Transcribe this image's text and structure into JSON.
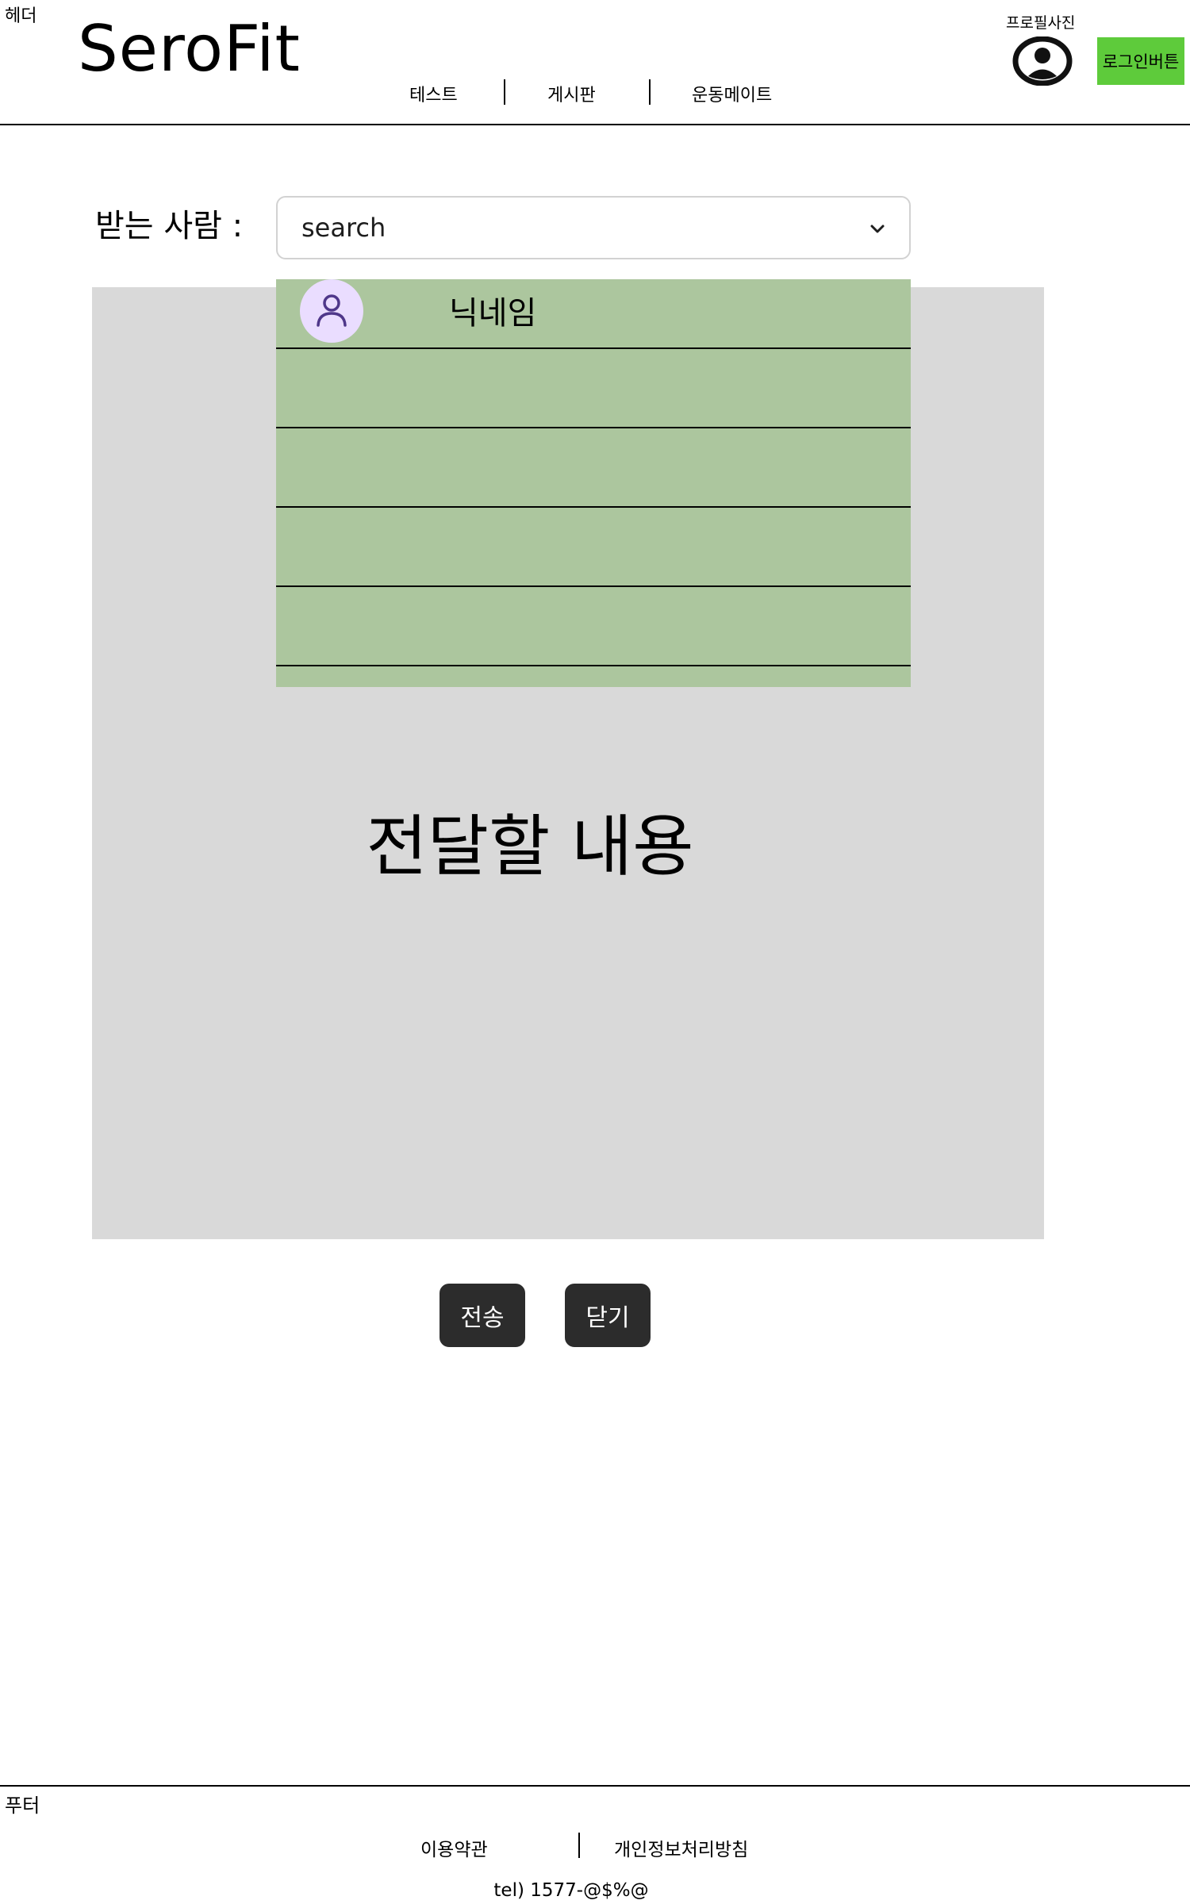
{
  "header": {
    "tag": "헤더",
    "logo": "SeroFit",
    "nav": [
      "테스트",
      "게시판",
      "운동메이트"
    ],
    "profile_label": "프로필사진",
    "login_label": "로그인버튼",
    "login_color": "#5ecb3b"
  },
  "compose": {
    "recipient_label": "받는 사람 :",
    "search_value": "search",
    "dropdown": {
      "background": "#acc69e",
      "items": [
        {
          "nickname": "닉네임"
        },
        {
          "nickname": ""
        },
        {
          "nickname": ""
        },
        {
          "nickname": ""
        },
        {
          "nickname": ""
        }
      ]
    },
    "message_placeholder": "전달할 내용",
    "send_label": "전송",
    "close_label": "닫기"
  },
  "footer": {
    "tag": "푸터",
    "links": [
      "이용약관",
      "개인정보처리방침"
    ],
    "tel": "tel) 1577-@$%@"
  },
  "icons": {
    "profile": "profile-circle-icon",
    "chevron": "chevron-down-icon",
    "avatar": "person-icon"
  }
}
